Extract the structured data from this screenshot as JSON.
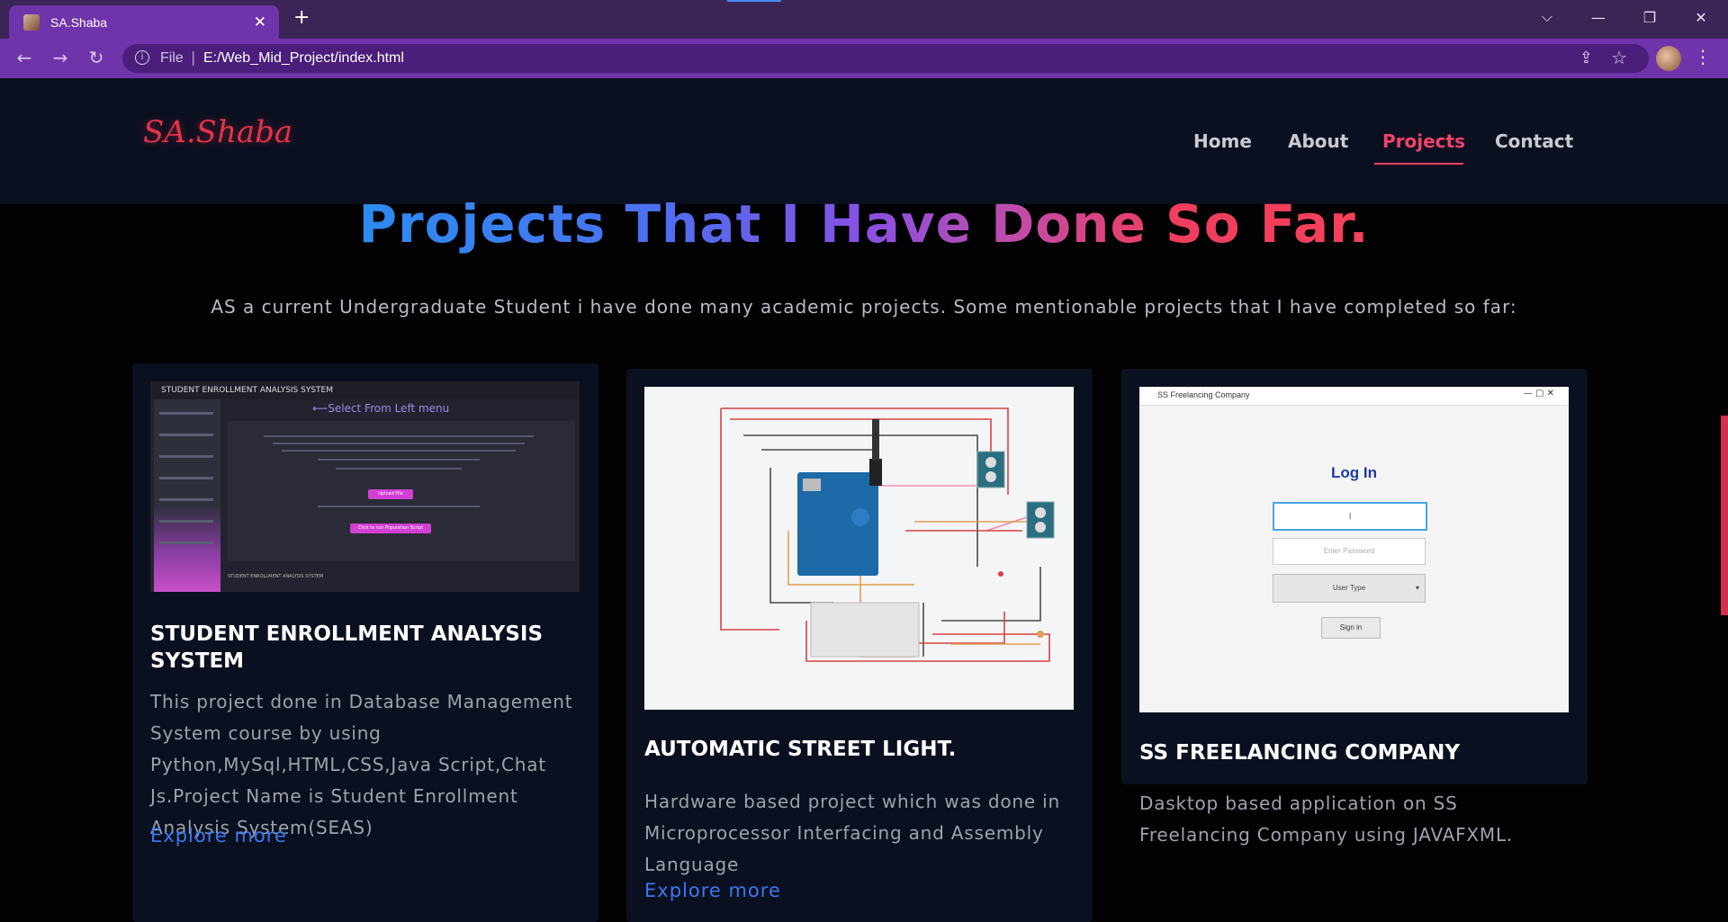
{
  "browser": {
    "tab_title": "SA.Shaba",
    "tab_close": "✕",
    "new_tab": "+",
    "url_scheme": "File",
    "url": "E:/Web_Mid_Project/index.html",
    "window_controls": [
      "⌵",
      "—",
      "❐",
      "✕"
    ]
  },
  "site": {
    "logo": "SA.Shaba",
    "nav": [
      {
        "label": "Home",
        "active": false
      },
      {
        "label": "About",
        "active": false
      },
      {
        "label": "Projects",
        "active": true
      },
      {
        "label": "Contact",
        "active": false
      }
    ],
    "colors": {
      "accent": "#f2426a",
      "link": "#3b78f0",
      "card_bg": "#0b1020"
    }
  },
  "hero": {
    "title": "Projects That I Have Done So Far.",
    "subtitle": "AS a current Undergraduate Student i have done many academic projects. Some mentionable projects that I have completed so far:"
  },
  "projects": [
    {
      "title": "STUDENT ENROLLMENT ANALYSIS SYSTEM",
      "description": "This project done in Database Management System course by using Python,MySql,HTML,CSS,Java Script,Chat Js.Project Name is Student Enrollment Analysis System(SEAS)",
      "link": "Explore more",
      "screenshot": {
        "header": "STUDENT ENROLLMENT ANALYSIS SYSTEM",
        "menu_hint": "⟵Select From Left menu",
        "upload_button": "Upload File",
        "run_button": "Click to run Population Script",
        "footer": "STUDENT ENROLLMENT ANALYSIS SYSTEM"
      }
    },
    {
      "title": "AUTOMATIC STREET LIGHT.",
      "description": "Hardware based project which was done in Microprocessor Interfacing and Assembly Language",
      "link": "Explore more"
    },
    {
      "title": "SS FREELANCING COMPANY",
      "description": "Dasktop based application on SS Freelancing Company using JAVAFXML.",
      "screenshot": {
        "window_title": "SS Freelancing Company",
        "heading": "Log In",
        "password_placeholder": "Enter Password",
        "user_type": "User Type",
        "sign_in": "Sign in"
      }
    }
  ]
}
